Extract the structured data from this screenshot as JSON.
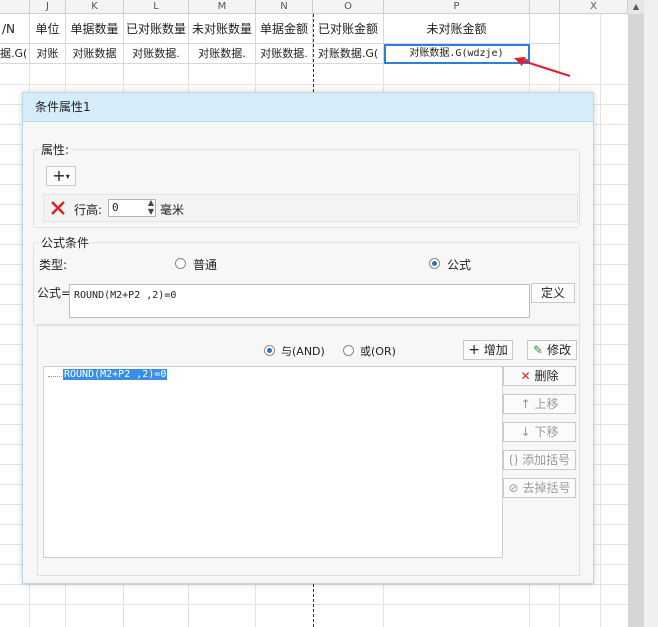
{
  "sheet": {
    "columns": [
      {
        "id": "col-i",
        "letter": ""
      },
      {
        "id": "col-j",
        "letter": "J"
      },
      {
        "id": "col-k",
        "letter": "K"
      },
      {
        "id": "col-l",
        "letter": "L"
      },
      {
        "id": "col-m",
        "letter": "M"
      },
      {
        "id": "col-n",
        "letter": "N"
      },
      {
        "id": "col-o",
        "letter": "O"
      },
      {
        "id": "col-p",
        "letter": "P"
      },
      {
        "id": "col-q",
        "letter": ""
      },
      {
        "id": "col-x",
        "letter": "X"
      }
    ],
    "header_row": [
      "/N",
      "单位",
      "单据数量",
      "已对账数量",
      "未对账数量",
      "单据金额",
      "已对账金额",
      "未对账金额"
    ],
    "data_row": [
      "据.G(",
      "对账",
      "对账数据",
      "对账数据.",
      "对账数据.",
      "对账数据.",
      "对账数据.G(",
      "对账数据.G(wdzje)"
    ]
  },
  "dialog": {
    "title": "条件属性1",
    "properties": {
      "group_label": "属性:",
      "add_icon": "plus-icon",
      "delete_icon": "red-x-icon",
      "row_height_label": "行高:",
      "row_height_value": "0",
      "unit_label": "毫米"
    },
    "formula": {
      "group_label": "公式条件",
      "type_label": "类型:",
      "type_options": {
        "normal": "普通",
        "formula": "公式"
      },
      "selected_type": "公式",
      "formula_label": "公式=",
      "formula_value": "ROUND(M2+P2 ,2)=0",
      "define_button": "定义"
    },
    "conditions": {
      "and_label": "与(AND)",
      "or_label": "或(OR)",
      "selected_logic": "与(AND)",
      "add_button": "增加",
      "modify_button": "修改",
      "items": [
        "ROUND(M2+P2 ,2)=0"
      ],
      "delete_button": "删除",
      "move_up_button": "上移",
      "move_down_button": "下移",
      "add_parens_button": "添加括号",
      "remove_parens_button": "去掉括号"
    }
  },
  "colors": {
    "dialog_title_bg": "#d6ecf8",
    "selection_blue": "#2f7fd8",
    "arrow_red": "#e0202a",
    "highlight": "#3a8ee6"
  }
}
